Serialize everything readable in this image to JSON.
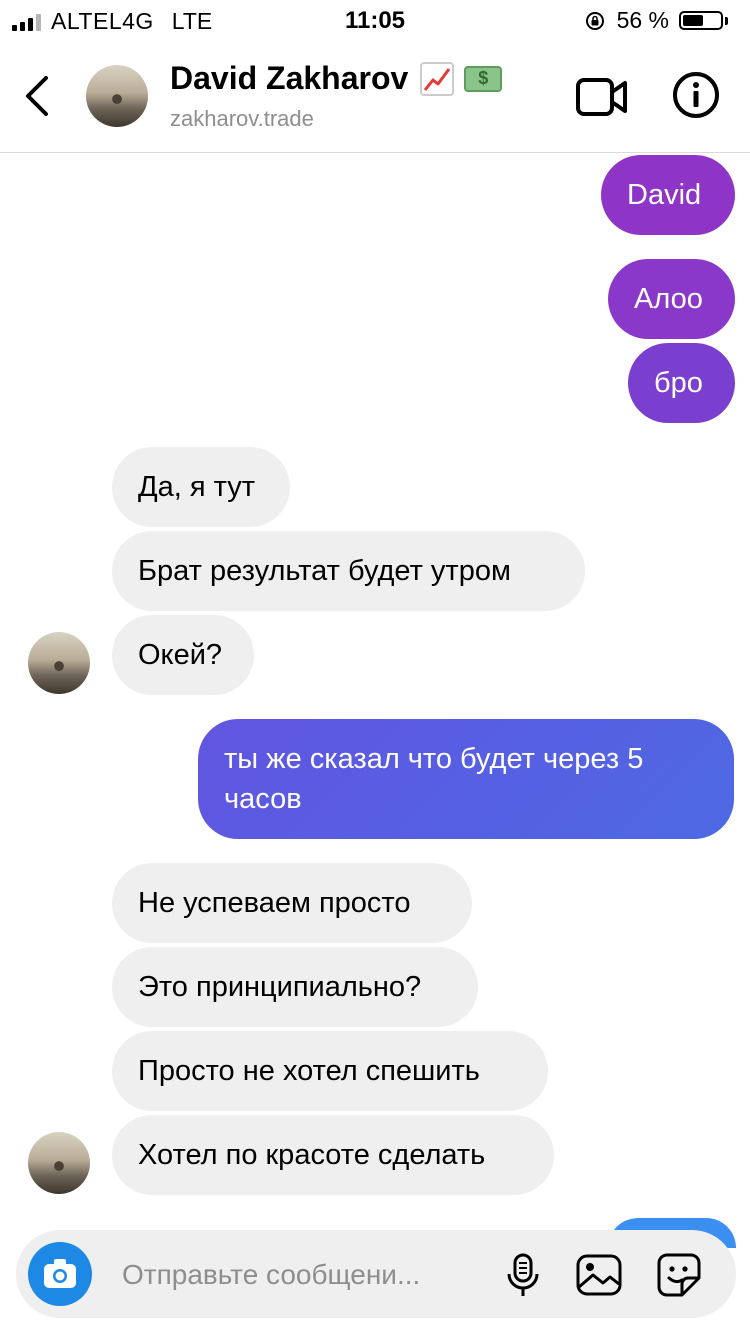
{
  "status_bar": {
    "carrier": "ALTEL4G",
    "network": "LTE",
    "time": "11:05",
    "battery_text": "56 %",
    "battery_level": 0.56
  },
  "header": {
    "name": "David Zakharov",
    "username": "zakharov.trade",
    "name_emojis": [
      "chart-increasing-emoji",
      "money-bag-emoji"
    ]
  },
  "messages": [
    {
      "dir": "out",
      "text": "David",
      "color": "#8e35c7"
    },
    {
      "dir": "out",
      "text": "Алоо",
      "color": "#8a38c9"
    },
    {
      "dir": "out",
      "text": "бро",
      "color": "#7b3fd0"
    },
    {
      "dir": "in",
      "text": "Да, я тут"
    },
    {
      "dir": "in",
      "text": "Брат результат будет утром"
    },
    {
      "dir": "in",
      "text": "Окей?"
    },
    {
      "dir": "out",
      "text": "ты же сказал что будет через 5 часов",
      "color": "#5561df"
    },
    {
      "dir": "in",
      "text": "Не успеваем просто"
    },
    {
      "dir": "in",
      "text": "Это принципиально?"
    },
    {
      "dir": "in",
      "text": "Просто не хотел спешить"
    },
    {
      "dir": "in",
      "text": "Хотел по красоте сделать"
    }
  ],
  "composer": {
    "placeholder": "Отправьте сообщени..."
  },
  "colors": {
    "incoming_bubble": "#efefef",
    "camera_button": "#1e88e5",
    "gradient_top": "#9c33c4",
    "gradient_bottom": "#4f6ae6"
  }
}
